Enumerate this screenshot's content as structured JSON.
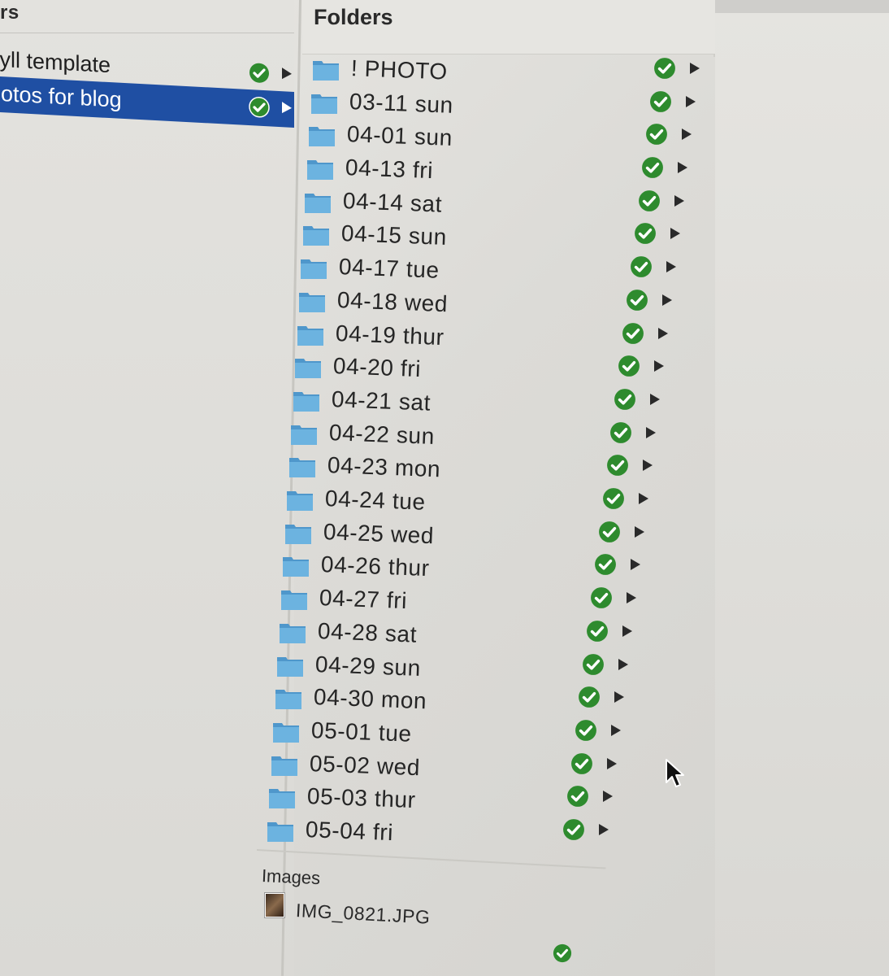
{
  "left_column": {
    "header": "rs",
    "items": [
      {
        "label": "kyll template",
        "synced": true,
        "selected": false
      },
      {
        "label": "hotos for blog",
        "synced": true,
        "selected": true
      }
    ]
  },
  "folders_column": {
    "header": "Folders",
    "folders": [
      "! PHOTO",
      "03-11 sun",
      "04-01 sun",
      "04-13 fri",
      "04-14 sat",
      "04-15 sun",
      "04-17 tue",
      "04-18 wed",
      "04-19 thur",
      "04-20 fri",
      "04-21 sat",
      "04-22 sun",
      "04-23 mon",
      "04-24 tue",
      "04-25 wed",
      "04-26 thur",
      "04-27 fri",
      "04-28 sat",
      "04-29 sun",
      "04-30 mon",
      "05-01 tue",
      "05-02 wed",
      "05-03 thur",
      "05-04 fri"
    ],
    "status_icon": "green-check-icon",
    "expand_icon": "play-arrow-icon"
  },
  "images_section": {
    "header": "Images",
    "items": [
      {
        "name": "IMG_0821.JPG",
        "synced": true
      }
    ]
  },
  "colors": {
    "selection": "#1f4fa3",
    "folder_blue": "#5ba3d4",
    "check_green": "#2e8b2e"
  }
}
